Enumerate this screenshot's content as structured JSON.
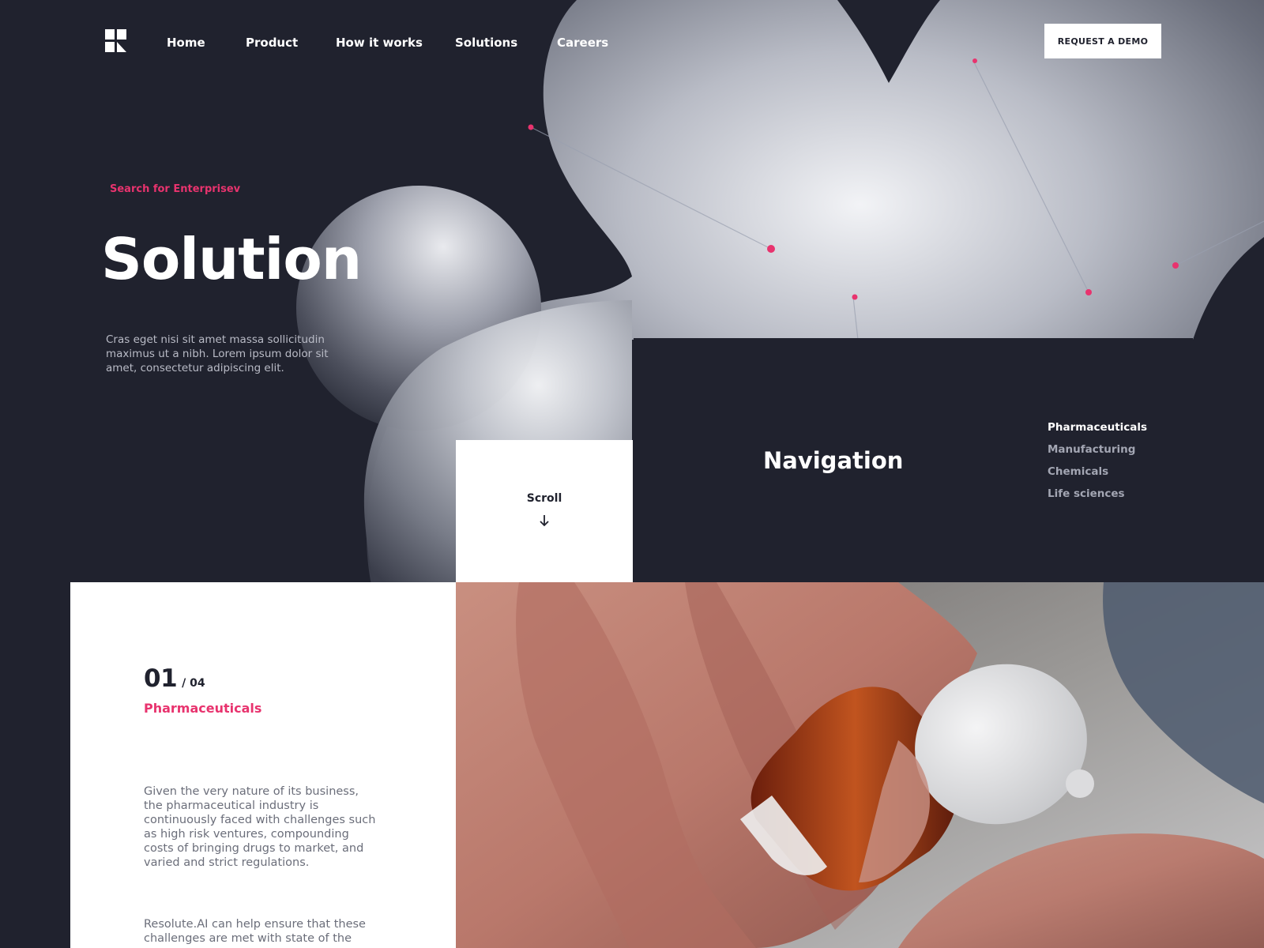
{
  "header": {
    "logo": "logo-icon",
    "nav": [
      "Home",
      "Product",
      "How it works",
      "Solutions",
      "Careers"
    ],
    "cta_label": "REQUEST A DEMO"
  },
  "hero": {
    "eyebrow": "Search for Enterprisev",
    "title": "Solution",
    "description": "Cras eget nisi sit amet massa sollicitudin maximus ut a nibh. Lorem ipsum dolor sit amet, consectetur adipiscing elit."
  },
  "scroll": {
    "label": "Scroll",
    "icon": "arrow-down-icon"
  },
  "navigation_panel": {
    "title": "Navigation",
    "items": [
      {
        "label": "Pharmaceuticals",
        "active": true
      },
      {
        "label": "Manufacturing",
        "active": false
      },
      {
        "label": "Chemicals",
        "active": false
      },
      {
        "label": "Life sciences",
        "active": false
      }
    ]
  },
  "section": {
    "current": "01",
    "total": "/ 04",
    "heading": "Pharmaceuticals",
    "paragraph1": "Given the very nature of its business, the pharmaceutical industry is continuously faced with challenges such as high risk ventures, compounding costs of bringing drugs to market, and varied and strict regulations.",
    "paragraph2": "Resolute.AI can help ensure that these challenges are met with state of the"
  },
  "colors": {
    "background": "#20222e",
    "accent": "#e8336e",
    "white": "#ffffff",
    "muted_text": "#a3a6b3"
  }
}
